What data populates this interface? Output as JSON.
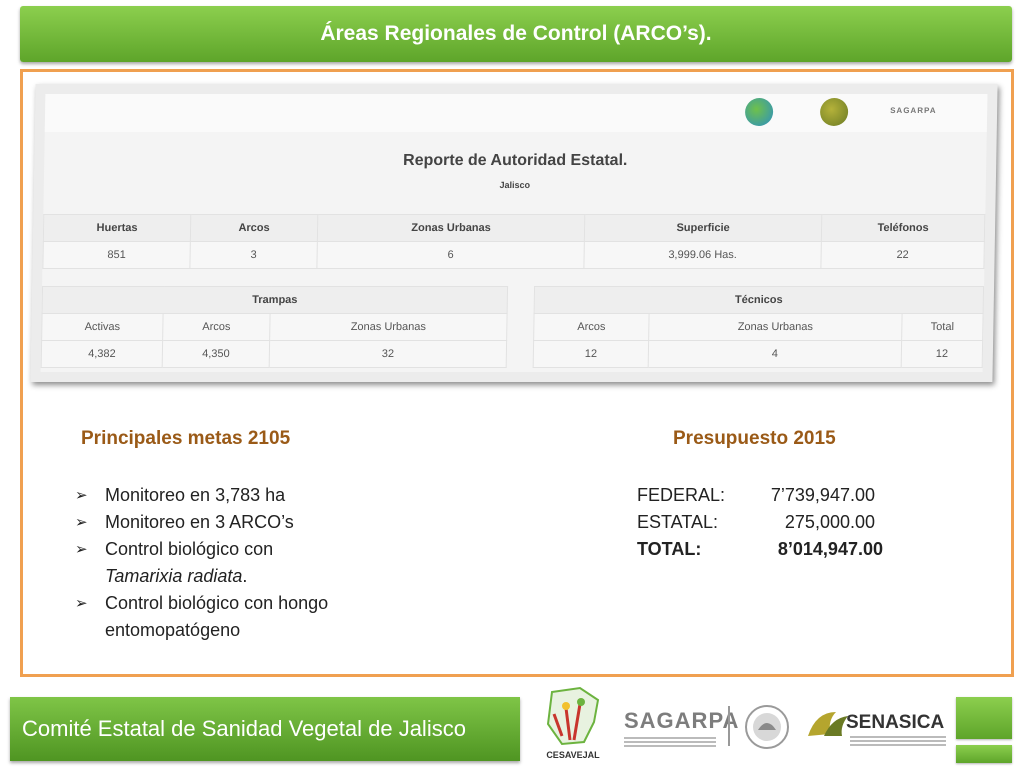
{
  "header": {
    "title": "Áreas Regionales de Control (ARCO’s)."
  },
  "report": {
    "title": "Reporte de Autoridad Estatal.",
    "subtitle": "Jalisco",
    "logo_text": "SAGARPA",
    "summary_headers": [
      "Huertas",
      "Arcos",
      "Zonas Urbanas",
      "Superficie",
      "Teléfonos"
    ],
    "summary_values": [
      "851",
      "3",
      "6",
      "3,999.06 Has.",
      "22"
    ],
    "trampas": {
      "title": "Trampas",
      "headers": [
        "Activas",
        "Arcos",
        "Zonas Urbanas"
      ],
      "values": [
        "4,382",
        "4,350",
        "32"
      ]
    },
    "tecnicos": {
      "title": "Técnicos",
      "headers": [
        "Arcos",
        "Zonas Urbanas",
        "Total"
      ],
      "values": [
        "12",
        "4",
        "12"
      ]
    }
  },
  "goals": {
    "title": "Principales metas 2105",
    "items": [
      "Monitoreo en 3,783 ha",
      "Monitoreo en 3 ARCO’s",
      "Control biológico con",
      "Tamarixia radiata",
      ".",
      "Control biológico con hongo entomopatógeno"
    ]
  },
  "budget": {
    "title": "Presupuesto 2015",
    "rows": [
      {
        "label": "FEDERAL:",
        "value": "7’739,947.00"
      },
      {
        "label": "ESTATAL:",
        "value": "275,000.00"
      },
      {
        "label": "TOTAL:",
        "value": "8’014,947.00"
      }
    ]
  },
  "footer": {
    "title": "Comité Estatal de Sanidad Vegetal de Jalisco",
    "logos": {
      "cesavejal": "CESAVEJAL",
      "sagarpa": "SAGARPA",
      "senasica": "SENASICA"
    }
  },
  "colors": {
    "green": "#6cb33f",
    "orange_border": "#f0a050",
    "heading_brown": "#9a5a17"
  }
}
